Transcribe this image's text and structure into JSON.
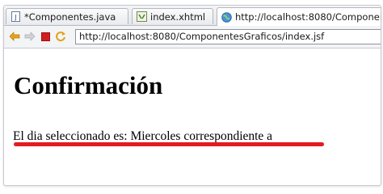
{
  "tabs": [
    {
      "label": "*Componentes.java",
      "icon": "java-file-icon"
    },
    {
      "label": "index.xhtml",
      "icon": "xhtml-file-icon"
    },
    {
      "label": "http://localhost:8080/Componen",
      "icon": "globe-icon"
    }
  ],
  "toolbar": {
    "url": "http://localhost:8080/ComponentesGraficos/index.jsf"
  },
  "page": {
    "heading": "Confirmación",
    "message": "El dia seleccionado es: Miercoles correspondiente a"
  },
  "colors": {
    "underline": "#e21b22",
    "back_arrow": "#e8a317",
    "stop": "#d21f1f"
  }
}
